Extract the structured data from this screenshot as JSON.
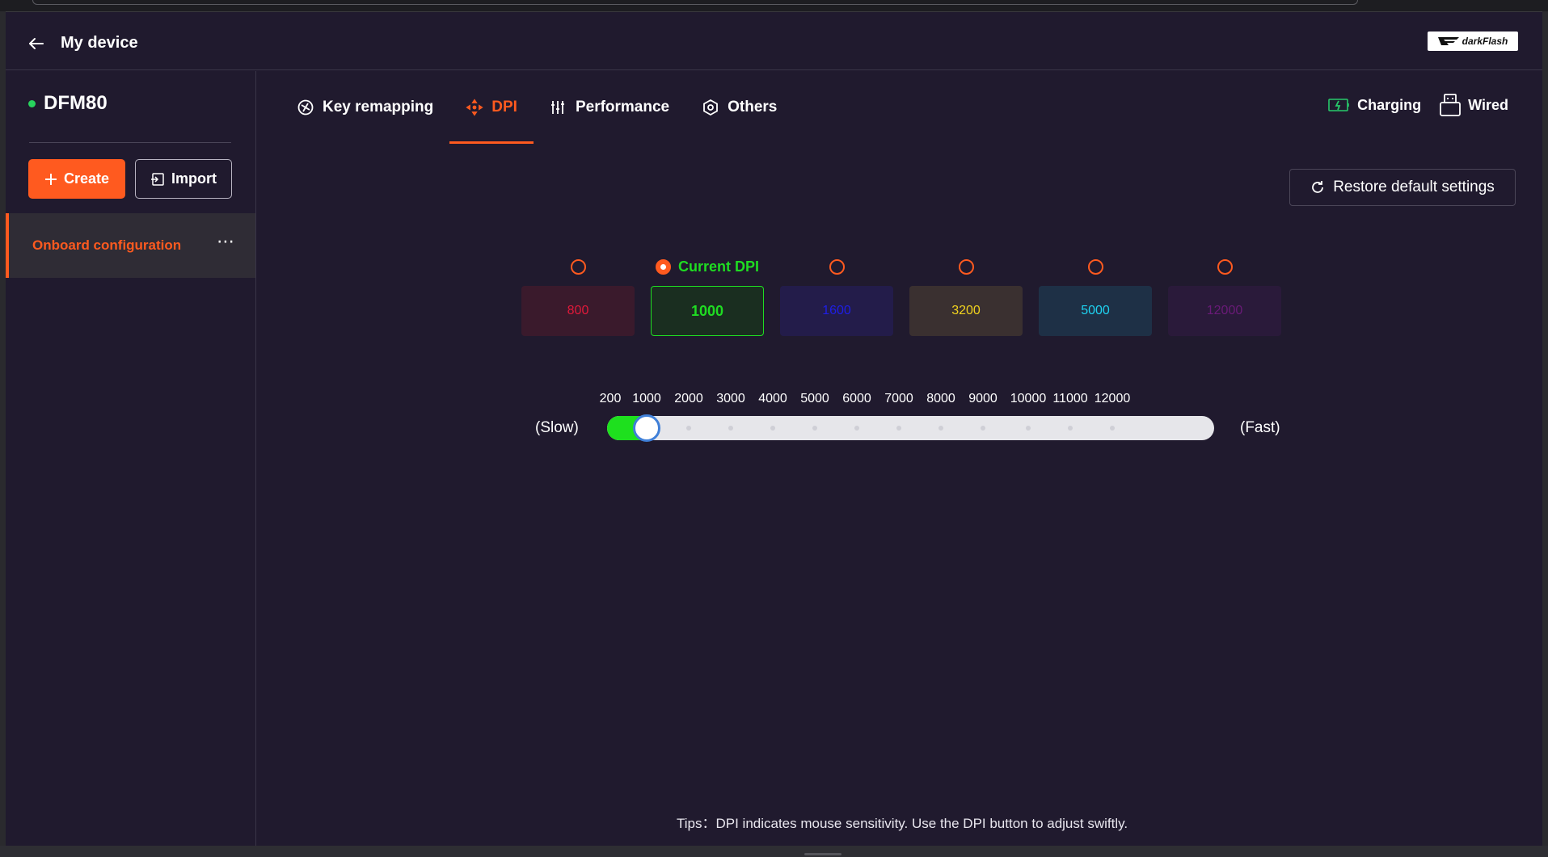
{
  "header": {
    "back_icon": "arrow-left-icon",
    "title": "My device",
    "brand": "darkFlash"
  },
  "sidebar": {
    "device_name": "DFM80",
    "device_status_color": "#27d35d",
    "create_label": "Create",
    "import_label": "Import",
    "config_item": {
      "label": "Onboard configuration",
      "more": "⋯",
      "active": true
    }
  },
  "tabs": [
    {
      "label": "Key remapping",
      "icon": "key-remap-icon",
      "active": false
    },
    {
      "label": "DPI",
      "icon": "dpi-crosshair-icon",
      "active": true
    },
    {
      "label": "Performance",
      "icon": "sliders-icon",
      "active": false
    },
    {
      "label": "Others",
      "icon": "hexagon-settings-icon",
      "active": false
    }
  ],
  "status": {
    "battery_label": "Charging",
    "connection_label": "Wired"
  },
  "restore_label": "Restore default settings",
  "dpi": {
    "current_label": "Current DPI",
    "levels": [
      {
        "value": "800",
        "color": "#e0193a",
        "bg": "#3a1a2c",
        "selected": false
      },
      {
        "value": "1000",
        "color": "#1fdc22",
        "bg": "#1a2e20",
        "selected": true
      },
      {
        "value": "1600",
        "color": "#1e1ee6",
        "bg": "#231c4a",
        "selected": false
      },
      {
        "value": "3200",
        "color": "#f0d21e",
        "bg": "#3a3030",
        "selected": false
      },
      {
        "value": "5000",
        "color": "#1ed2f0",
        "bg": "#1e3046",
        "selected": false
      },
      {
        "value": "12000",
        "color": "#6a1a78",
        "bg": "#2a1a3a",
        "selected": false
      }
    ]
  },
  "slider": {
    "ticks": [
      "200",
      "1000",
      "2000",
      "3000",
      "4000",
      "5000",
      "6000",
      "7000",
      "8000",
      "9000",
      "10000",
      "11000",
      "12000"
    ],
    "slow_label": "(Slow)",
    "fast_label": "(Fast)",
    "value": 1000,
    "min": 200,
    "max": 12000,
    "fill_color": "#1ee01e"
  },
  "tips": "Tips：DPI indicates mouse sensitivity. Use the DPI button to adjust swiftly."
}
